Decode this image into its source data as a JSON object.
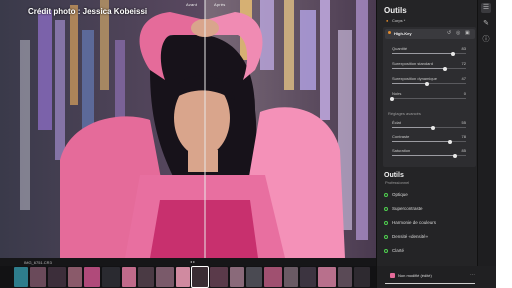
{
  "photo": {
    "credit": "Crédit photo : Jessica Kobeissi",
    "before_label": "Avant",
    "after_label": "Après"
  },
  "panel": {
    "title": "Outils",
    "section_body": "Corps *",
    "layer_name": "High-Key",
    "sliders": [
      {
        "label": "Quantité",
        "value": "83",
        "fraction": 0.83
      },
      {
        "label": "Surexposition standard",
        "value": "72",
        "fraction": 0.72
      },
      {
        "label": "Surexposition dynamique",
        "value": "47",
        "fraction": 0.47
      },
      {
        "label": "Noirs",
        "value": "0",
        "fraction": 0.0
      }
    ],
    "advanced_section": "Réglages avancés",
    "advanced_sliders": [
      {
        "label": "Éclat",
        "value": "55",
        "fraction": 0.55
      },
      {
        "label": "Contraste",
        "value": "78",
        "fraction": 0.78
      },
      {
        "label": "Saturation",
        "value": "85",
        "fraction": 0.85
      }
    ],
    "tools_title": "Outils",
    "pro_label": "Professionnel",
    "presets": [
      "Optique",
      "Supercontraste",
      "Harmonie de couleurs",
      "Densité «densité»",
      "Clarté"
    ]
  },
  "filmstrip": {
    "label": "IMG_6751.CR3",
    "status": "Non modifié (édité)"
  },
  "icons": {
    "sliders": "sliders-icon",
    "brush": "brush-icon",
    "info": "info-icon"
  },
  "colors": {
    "accent_green": "#4fd14f",
    "preset_orange": "#e08a2e",
    "sweater_pink": "#e56b9a"
  }
}
